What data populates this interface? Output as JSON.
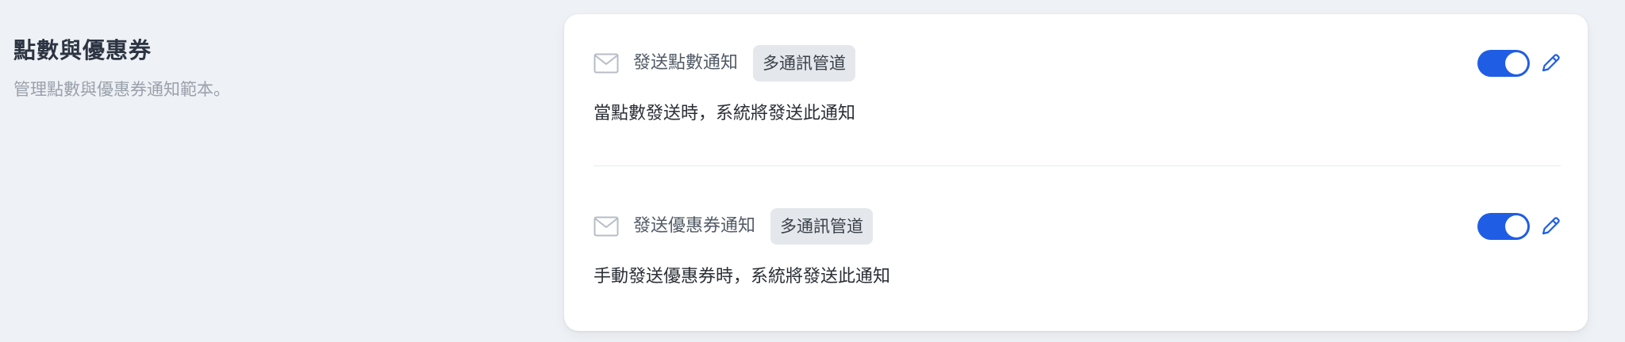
{
  "section": {
    "title": "點數與優惠券",
    "description": "管理點數與優惠券通知範本。"
  },
  "notifications": [
    {
      "name": "發送點數通知",
      "tag": "多通訊管道",
      "description": "當點數發送時，系統將發送此通知",
      "enabled": true,
      "icon": "mail-icon",
      "edit_icon": "pencil-icon"
    },
    {
      "name": "發送優惠券通知",
      "tag": "多通訊管道",
      "description": "手動發送優惠券時，系統將發送此通知",
      "enabled": true,
      "icon": "mail-icon",
      "edit_icon": "pencil-icon"
    }
  ],
  "colors": {
    "accent": "#1f5de4",
    "background": "#eef1f5",
    "card": "#ffffff",
    "tag_bg": "#e4e7eb"
  }
}
